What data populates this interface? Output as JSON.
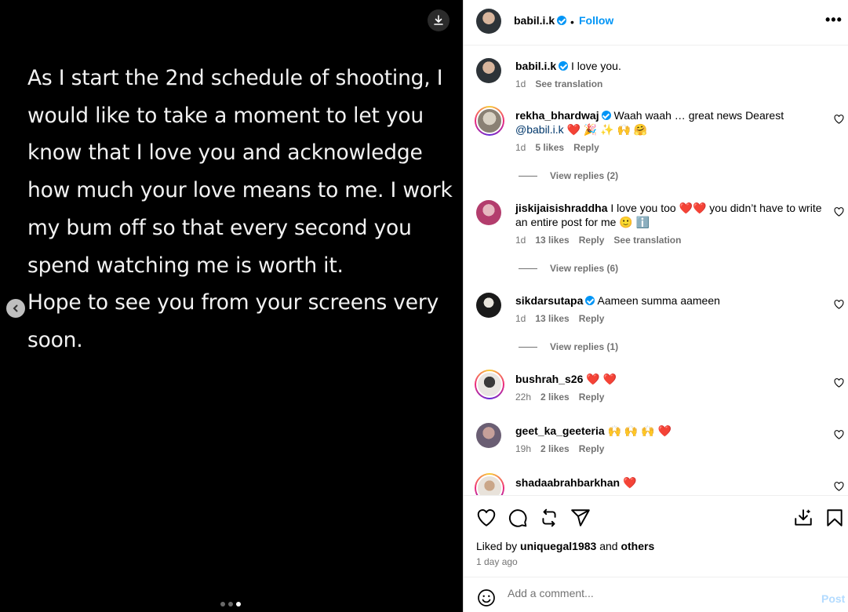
{
  "media": {
    "lines": [
      "As I start the 2nd schedule of shooting, I",
      "would like to take a moment to let you",
      "know that I love you and acknowledge",
      "how much your love means to me. I work",
      "my bum off so that every second you",
      "spend watching me is worth it.",
      "Hope to see you from your screens very",
      "soon."
    ],
    "carousel_total": 3,
    "carousel_active": 3
  },
  "header": {
    "username": "babil.i.k",
    "separator": "•",
    "follow_label": "Follow",
    "more_label": "•••"
  },
  "caption": {
    "username": "babil.i.k",
    "text": "I love you.",
    "time": "1d",
    "see_translation": "See translation"
  },
  "comments": [
    {
      "username": "rekha_bhardwaj",
      "verified": true,
      "text": "Waah waah … great news Dearest",
      "mention": "@babil.i.k",
      "emojis": "❤️ 🎉 ✨ 🙌 🤗",
      "time": "1d",
      "likes": "5 likes",
      "reply": "Reply",
      "view_replies": "View replies (2)"
    },
    {
      "username": "jiskijaisishraddha",
      "verified": false,
      "text": "I love you too ❤️❤️ you didn’t have to write an entire post for me",
      "emojis": "🙂 ℹ️",
      "time": "1d",
      "likes": "13 likes",
      "reply": "Reply",
      "see_translation": "See translation",
      "view_replies": "View replies (6)"
    },
    {
      "username": "sikdarsutapa",
      "verified": true,
      "text": "Aameen summa aameen",
      "time": "1d",
      "likes": "13 likes",
      "reply": "Reply",
      "view_replies": "View replies (1)"
    },
    {
      "username": "bushrah_s26",
      "verified": false,
      "emojis": "❤️ ❤️",
      "time": "22h",
      "likes": "2 likes",
      "reply": "Reply"
    },
    {
      "username": "geet_ka_geeteria",
      "verified": false,
      "emojis": "🙌 🙌 🙌 ❤️",
      "time": "19h",
      "likes": "2 likes",
      "reply": "Reply"
    },
    {
      "username": "shadaabrahbarkhan",
      "verified": false,
      "emojis": "❤️"
    }
  ],
  "likes": {
    "prefix": "Liked by",
    "user": "uniquegal1983",
    "and": "and",
    "others": "others",
    "time": "1 day ago"
  },
  "add_comment": {
    "placeholder": "Add a comment...",
    "post_label": "Post"
  },
  "colors": {
    "accent": "#0095f6",
    "post_disabled": "#b3dbff",
    "heart_red": "#e0245e"
  }
}
